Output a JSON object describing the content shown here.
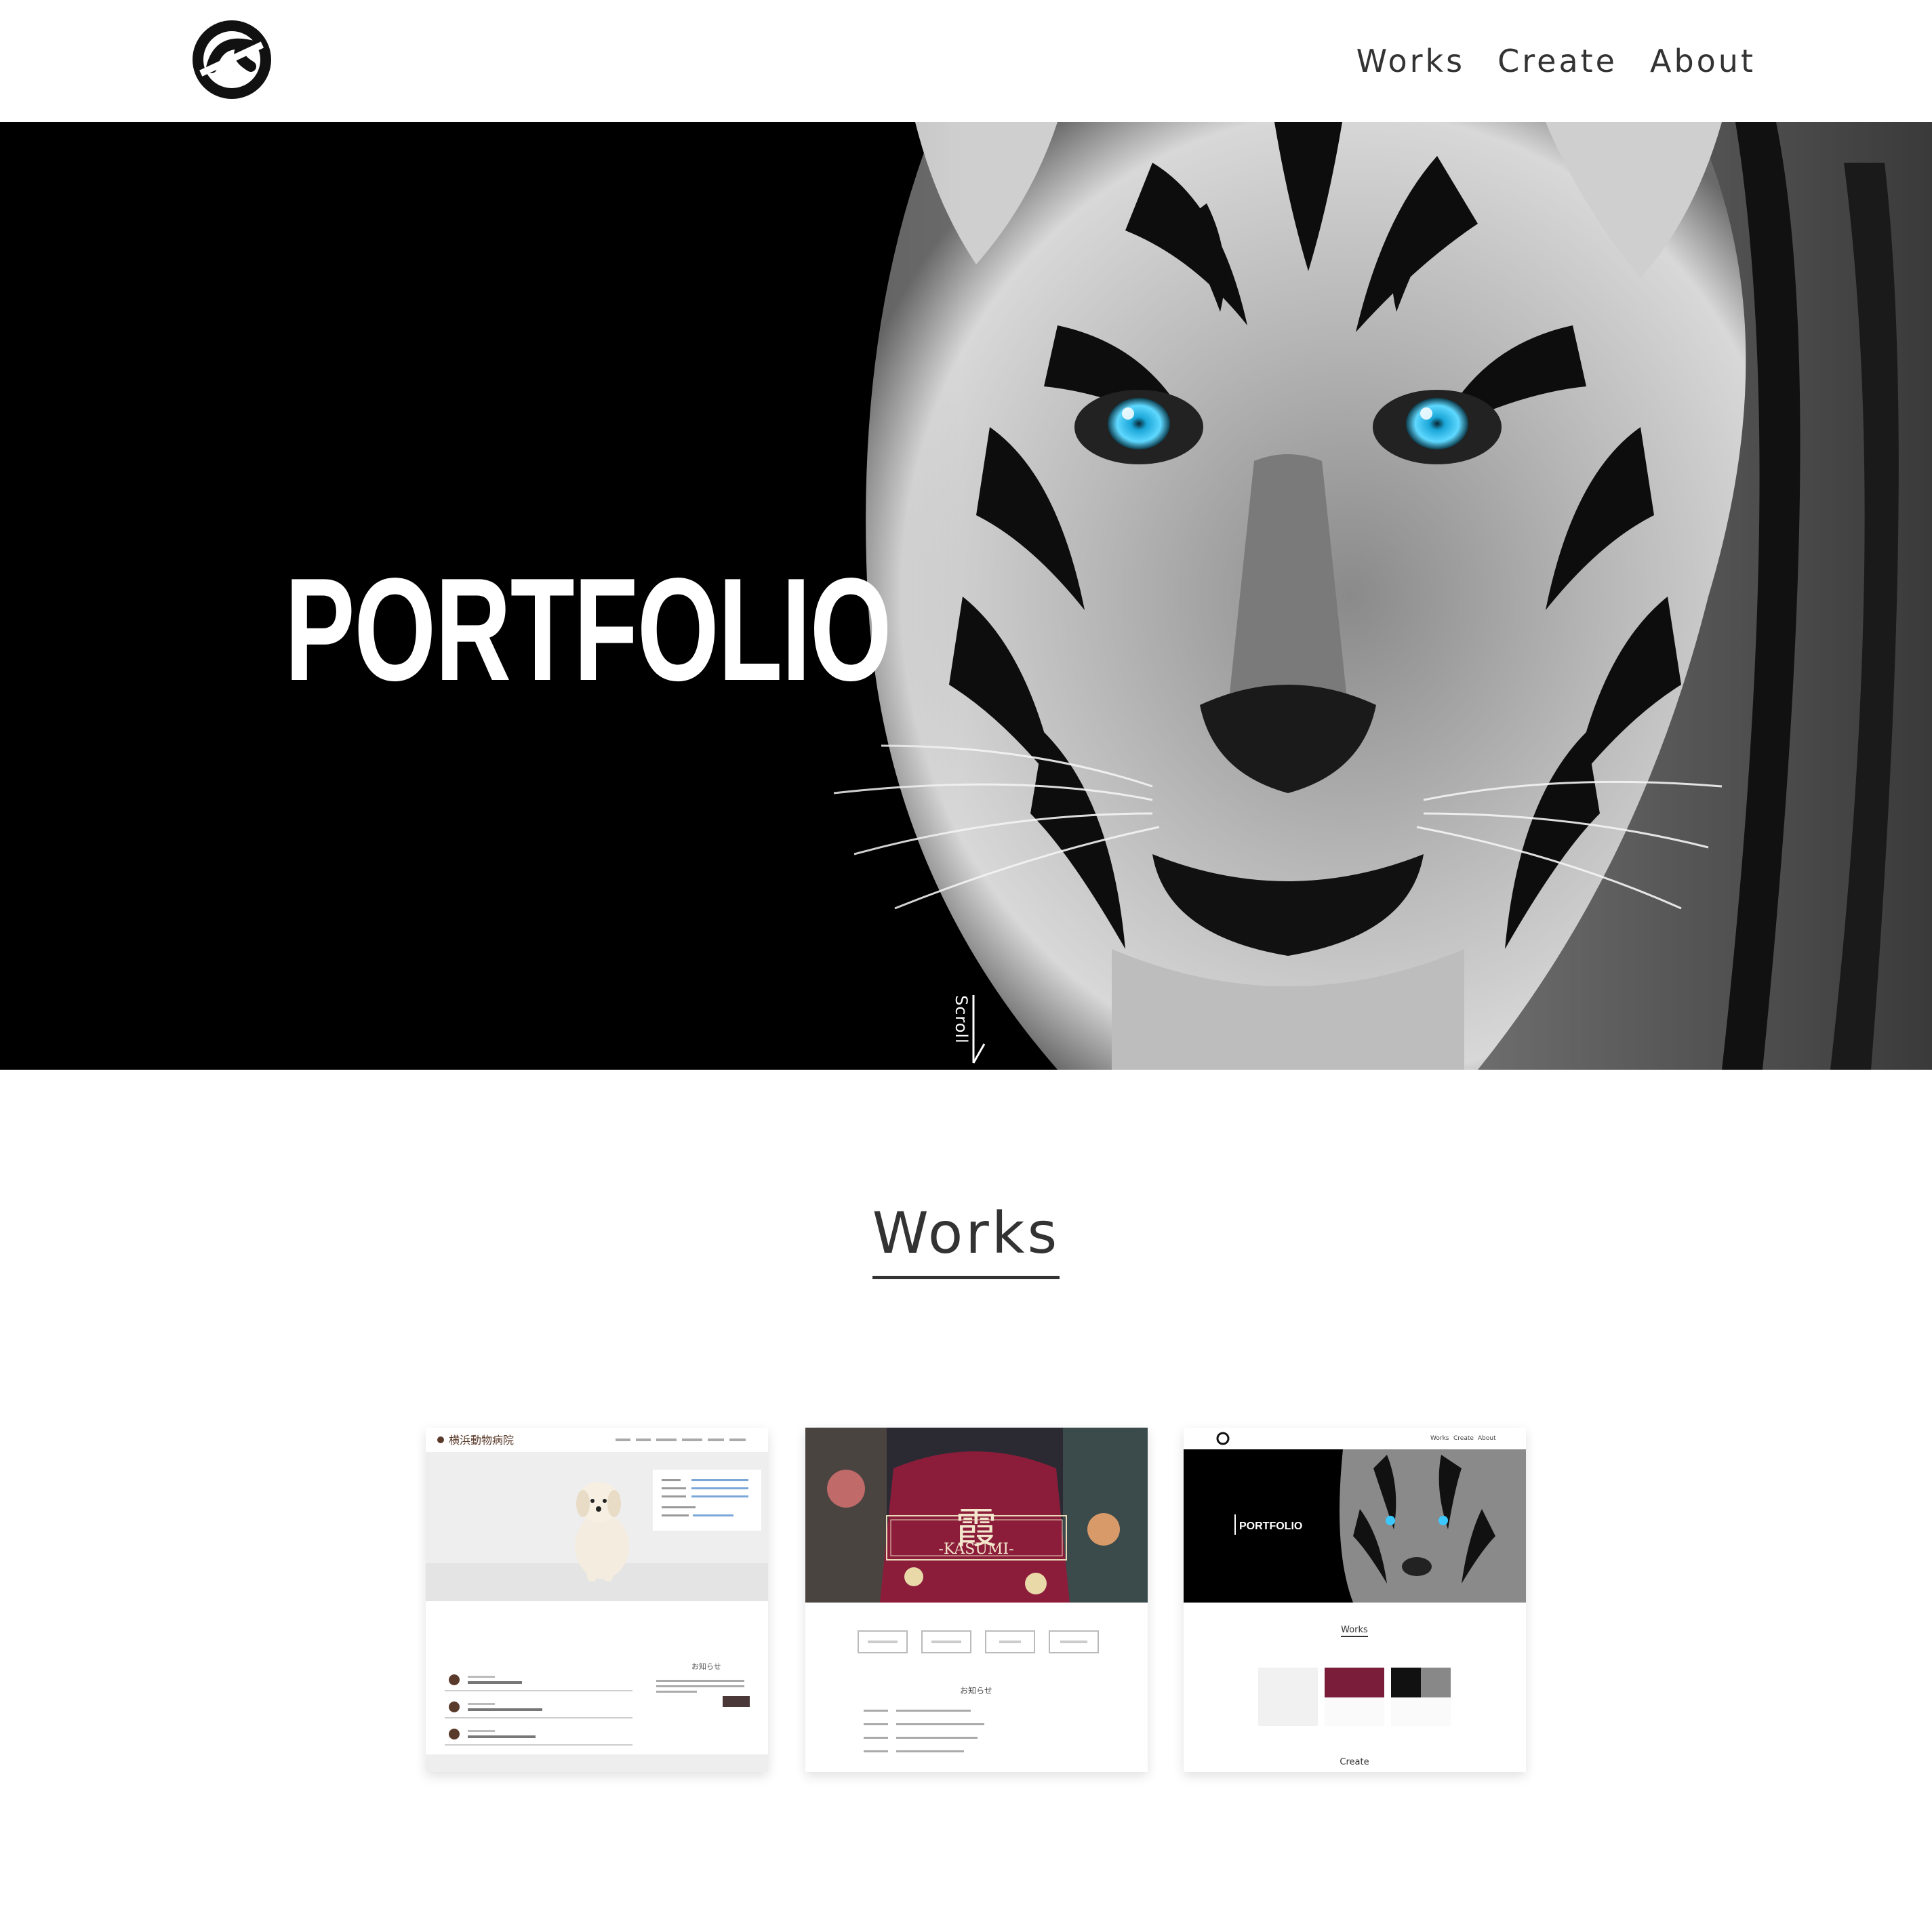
{
  "nav": {
    "items": [
      "Works",
      "Create",
      "About"
    ]
  },
  "hero": {
    "title": "PORTFOLIO",
    "scroll_label": "Scroll"
  },
  "works": {
    "title": "Works",
    "cards": [
      {
        "site_name": "横浜動物病院",
        "notice_title": "お知らせ"
      },
      {
        "kanji": "霞",
        "subtitle": "-KASUMI-",
        "notice_title": "お知らせ"
      },
      {
        "nav_items": [
          "Works",
          "Create",
          "About"
        ],
        "hero_title": "PORTFOLIO",
        "section_title": "Works",
        "footer_title": "Create"
      }
    ]
  },
  "colors": {
    "text": "#333333",
    "hero_bg": "#000000",
    "tiger_eye": "#3cc8ff"
  }
}
